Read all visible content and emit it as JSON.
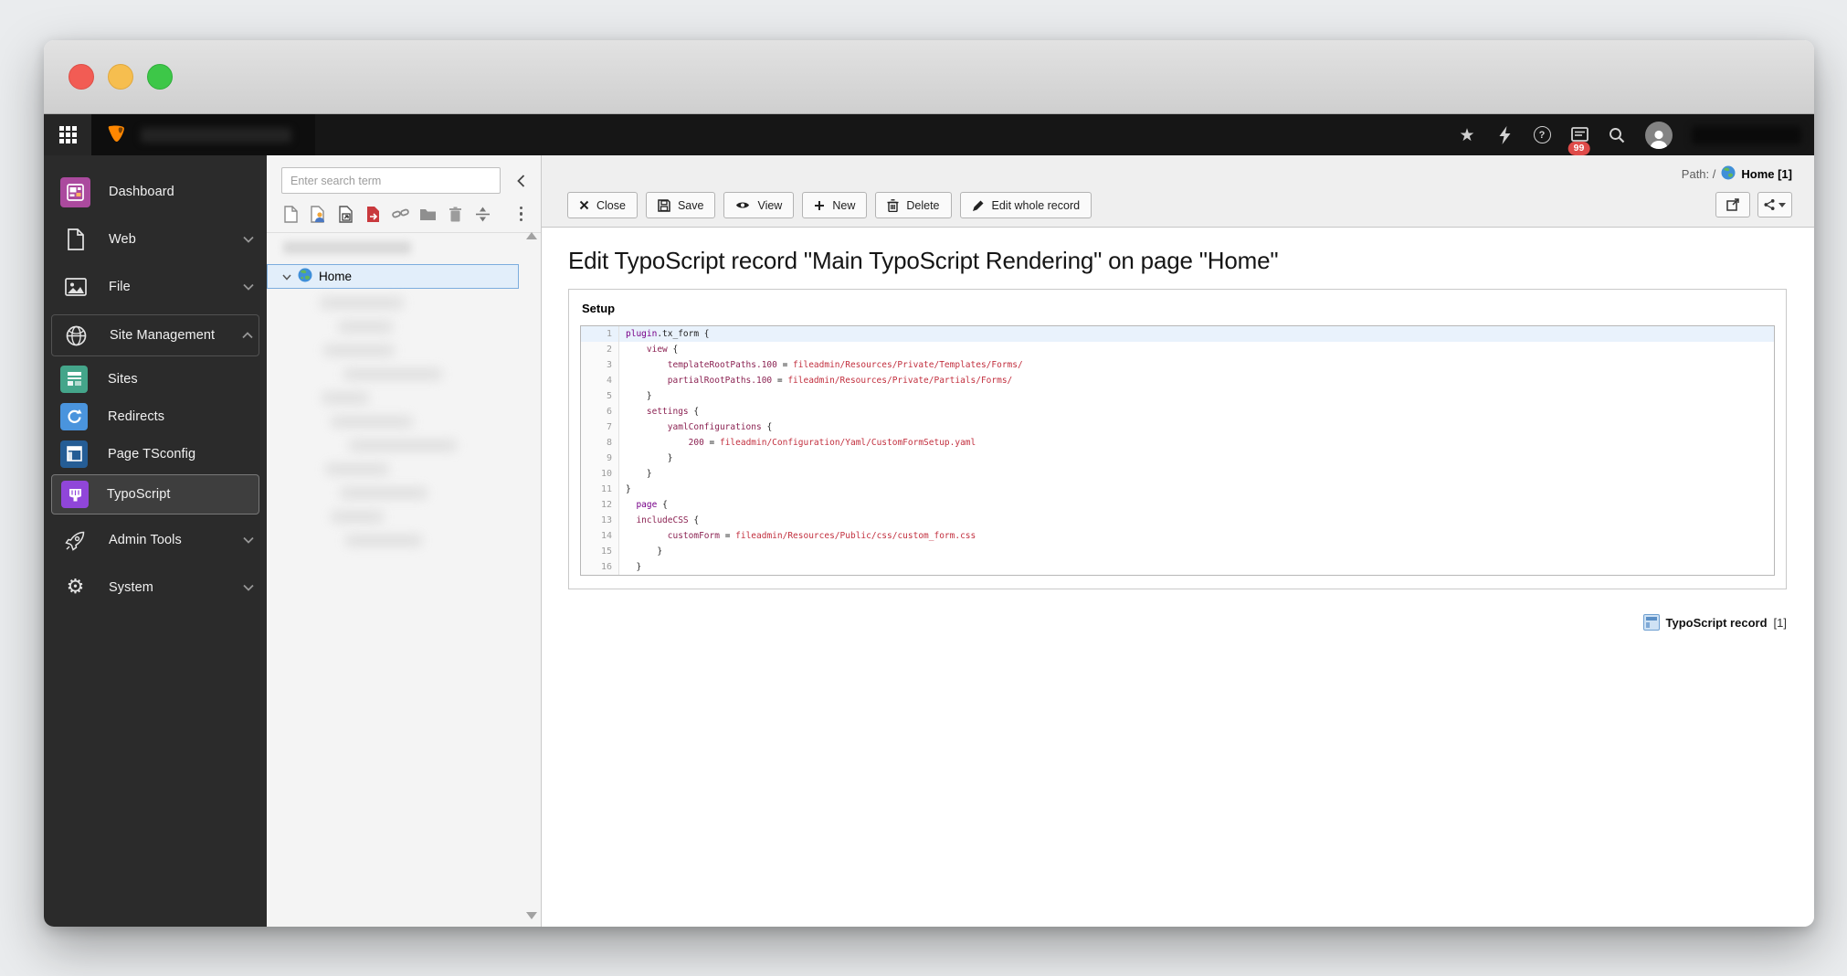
{
  "colors": {
    "brand_orange": "#ff8700",
    "topbar_bg": "#161616",
    "modulemenu_bg": "#2b2b2b",
    "badge_red": "#df4b49",
    "tree_selection_bg": "#e2eefa",
    "tree_selection_border": "#7cadde",
    "code_keyword": "#770088",
    "code_property": "#8b2252",
    "code_value": "#c22f3e",
    "active_line_bg": "#e9f2fc"
  },
  "topbar": {
    "badge_count": "99"
  },
  "module_menu": {
    "items": [
      {
        "label": "Dashboard"
      },
      {
        "label": "Web"
      },
      {
        "label": "File"
      },
      {
        "label": "Site Management"
      },
      {
        "label": "Sites"
      },
      {
        "label": "Redirects"
      },
      {
        "label": "Page TSconfig"
      },
      {
        "label": "TypoScript"
      },
      {
        "label": "Admin Tools"
      },
      {
        "label": "System"
      }
    ]
  },
  "page_tree": {
    "search_placeholder": "Enter search term",
    "home_label": "Home"
  },
  "docheader": {
    "path_prefix": "Path: /",
    "path_page": "Home [1]",
    "buttons": {
      "close": "Close",
      "save": "Save",
      "view": "View",
      "new": "New",
      "delete": "Delete",
      "edit_whole_record": "Edit whole record"
    }
  },
  "content": {
    "title": "Edit TypoScript record \"Main TypoScript Rendering\" on page \"Home\"",
    "section_label": "Setup",
    "record_type_label": "TypoScript record",
    "record_count": "[1]"
  },
  "code_editor": {
    "active_line": 1,
    "lines": [
      [
        [
          "k",
          "plugin"
        ],
        [
          "o",
          ".tx_form {"
        ]
      ],
      [
        [
          "o",
          "    "
        ],
        [
          "p",
          "view"
        ],
        [
          "o",
          " {"
        ]
      ],
      [
        [
          "o",
          "        "
        ],
        [
          "p",
          "templateRootPaths.100"
        ],
        [
          "o",
          " = "
        ],
        [
          "v",
          "fileadmin/Resources/Private/Templates/Forms/"
        ]
      ],
      [
        [
          "o",
          "        "
        ],
        [
          "p",
          "partialRootPaths.100"
        ],
        [
          "o",
          " = "
        ],
        [
          "v",
          "fileadmin/Resources/Private/Partials/Forms/"
        ]
      ],
      [
        [
          "o",
          "    }"
        ]
      ],
      [
        [
          "o",
          "    "
        ],
        [
          "p",
          "settings"
        ],
        [
          "o",
          " {"
        ]
      ],
      [
        [
          "o",
          "        "
        ],
        [
          "p",
          "yamlConfigurations"
        ],
        [
          "o",
          " {"
        ]
      ],
      [
        [
          "o",
          "            "
        ],
        [
          "p",
          "200"
        ],
        [
          "o",
          " = "
        ],
        [
          "v",
          "fileadmin/Configuration/Yaml/CustomFormSetup.yaml"
        ]
      ],
      [
        [
          "o",
          "        }"
        ]
      ],
      [
        [
          "o",
          "    }"
        ]
      ],
      [
        [
          "o",
          "}"
        ]
      ],
      [
        [
          "o",
          "  "
        ],
        [
          "k",
          "page"
        ],
        [
          "o",
          " {"
        ]
      ],
      [
        [
          "o",
          "  "
        ],
        [
          "p",
          "includeCSS"
        ],
        [
          "o",
          " {"
        ]
      ],
      [
        [
          "o",
          "        "
        ],
        [
          "p",
          "customForm"
        ],
        [
          "o",
          " = "
        ],
        [
          "v",
          "fileadmin/Resources/Public/css/custom_form.css"
        ]
      ],
      [
        [
          "o",
          "      }"
        ]
      ],
      [
        [
          "o",
          "  }"
        ]
      ]
    ]
  }
}
